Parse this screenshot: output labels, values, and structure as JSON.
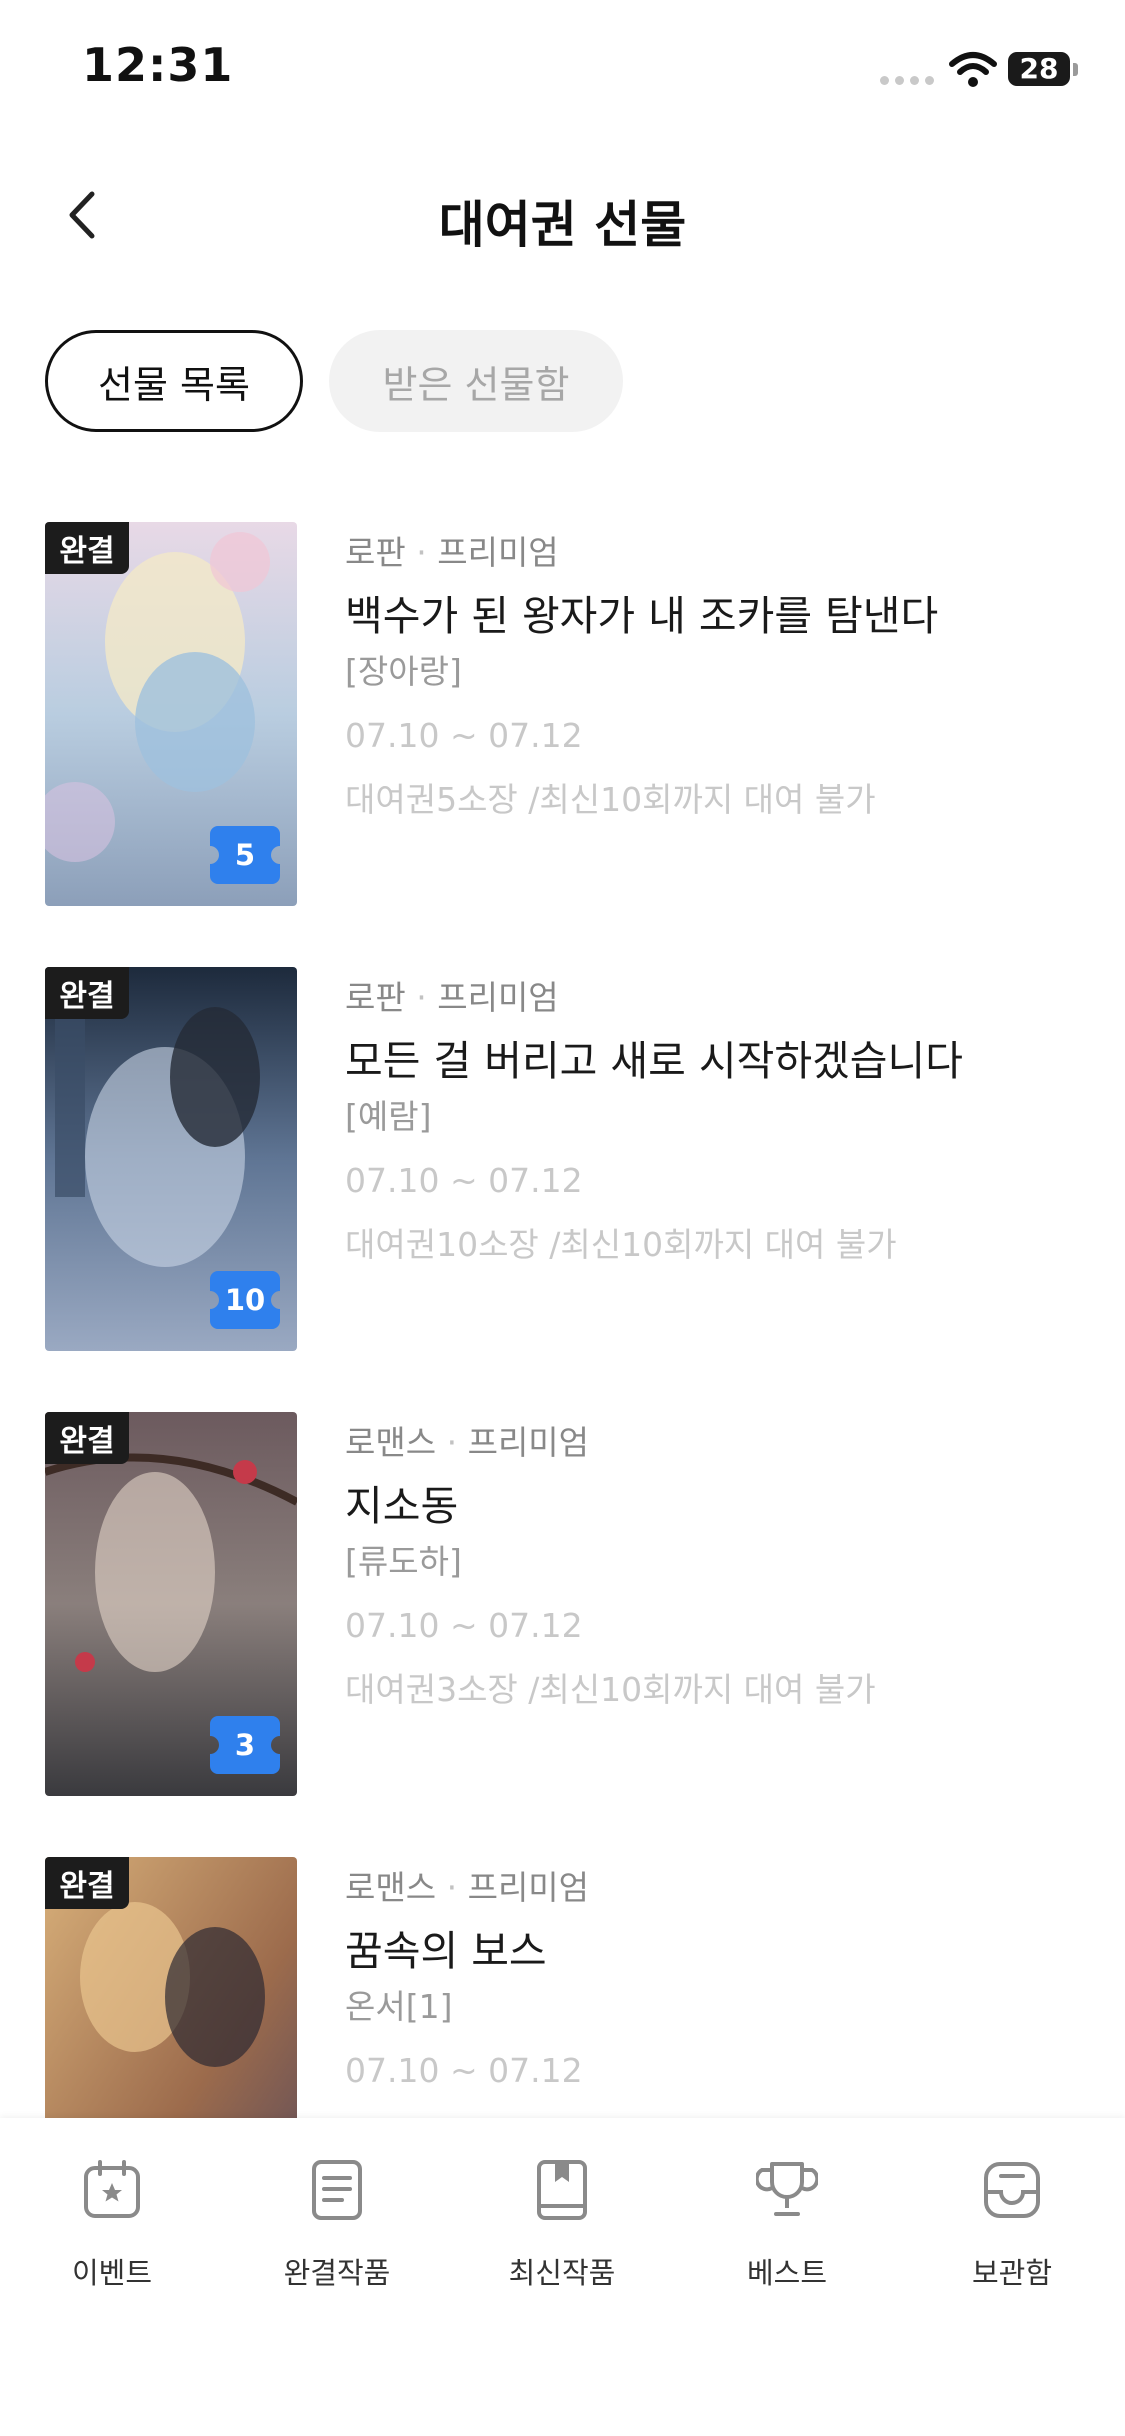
{
  "status_bar": {
    "time": "12:31",
    "battery": "28"
  },
  "header": {
    "title": "대여권 선물"
  },
  "tabs": [
    {
      "label": "선물 목록",
      "active": true
    },
    {
      "label": "받은 선물함",
      "active": false
    }
  ],
  "items": [
    {
      "badge": "완결",
      "ticket_count": "5",
      "genre": "로판",
      "category": "프리미엄",
      "title": "백수가 된 왕자가 내 조카를 탐낸다",
      "author": "[장아랑]",
      "period": "07.10 ~ 07.12",
      "detail": "대여권5소장 /최신10회까지 대여 불가"
    },
    {
      "badge": "완결",
      "ticket_count": "10",
      "genre": "로판",
      "category": "프리미엄",
      "title": "모든 걸 버리고 새로 시작하겠습니다",
      "author": "[예람]",
      "period": "07.10 ~ 07.12",
      "detail": "대여권10소장 /최신10회까지 대여 불가"
    },
    {
      "badge": "완결",
      "ticket_count": "3",
      "genre": "로맨스",
      "category": "프리미엄",
      "title": "지소동",
      "author": "[류도하]",
      "period": "07.10 ~ 07.12",
      "detail": "대여권3소장 /최신10회까지 대여 불가"
    },
    {
      "badge": "완결",
      "genre": "로맨스",
      "category": "프리미엄",
      "title": "꿈속의 보스",
      "author": "온서[1]",
      "period": "07.10 ~ 07.12"
    }
  ],
  "bottom_nav": [
    {
      "label": "이벤트",
      "icon": "calendar-star-icon"
    },
    {
      "label": "완결작품",
      "icon": "document-icon"
    },
    {
      "label": "최신작품",
      "icon": "book-bookmark-icon"
    },
    {
      "label": "베스트",
      "icon": "trophy-icon"
    },
    {
      "label": "보관함",
      "icon": "inbox-icon"
    }
  ],
  "colors": {
    "ticket_blue": "#2f80ed",
    "badge_dark": "#1c1c1c"
  }
}
